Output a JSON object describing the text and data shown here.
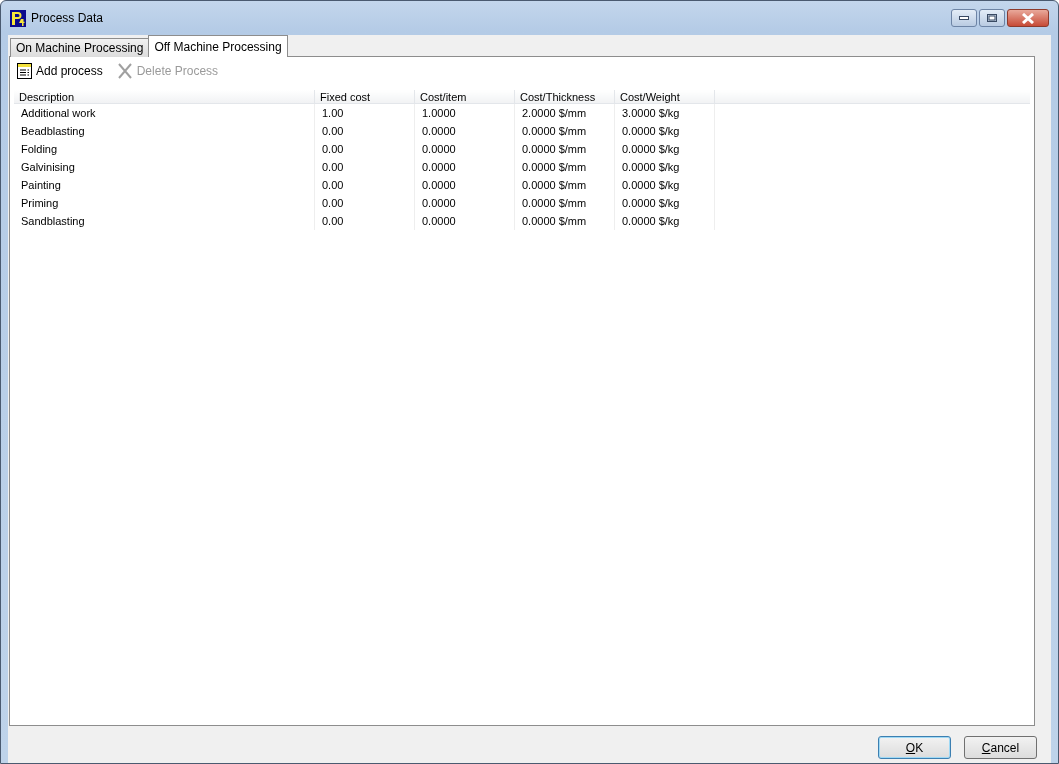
{
  "window": {
    "title": "Process Data"
  },
  "tabs": [
    {
      "label": "On Machine Processing",
      "selected": false
    },
    {
      "label": "Off Machine Processing",
      "selected": true
    }
  ],
  "toolbar": [
    {
      "label": "Add process",
      "kind": "add",
      "disabled": false
    },
    {
      "label": "Delete Process",
      "kind": "delete",
      "disabled": true
    }
  ],
  "table": {
    "columns": [
      "Description",
      "Fixed cost",
      "Cost/item",
      "Cost/Thickness",
      "Cost/Weight"
    ],
    "rows": [
      [
        "Additional work",
        "1.00",
        "1.0000",
        "2.0000 $/mm",
        "3.0000 $/kg"
      ],
      [
        "Beadblasting",
        "0.00",
        "0.0000",
        "0.0000 $/mm",
        "0.0000 $/kg"
      ],
      [
        "Folding",
        "0.00",
        "0.0000",
        "0.0000 $/mm",
        "0.0000 $/kg"
      ],
      [
        "Galvinising",
        "0.00",
        "0.0000",
        "0.0000 $/mm",
        "0.0000 $/kg"
      ],
      [
        "Painting",
        "0.00",
        "0.0000",
        "0.0000 $/mm",
        "0.0000 $/kg"
      ],
      [
        "Priming",
        "0.00",
        "0.0000",
        "0.0000 $/mm",
        "0.0000 $/kg"
      ],
      [
        "Sandblasting",
        "0.00",
        "0.0000",
        "0.0000 $/mm",
        "0.0000 $/kg"
      ]
    ]
  },
  "buttons": [
    {
      "label": "OK",
      "default": true
    },
    {
      "label": "Cancel",
      "default": false
    }
  ]
}
